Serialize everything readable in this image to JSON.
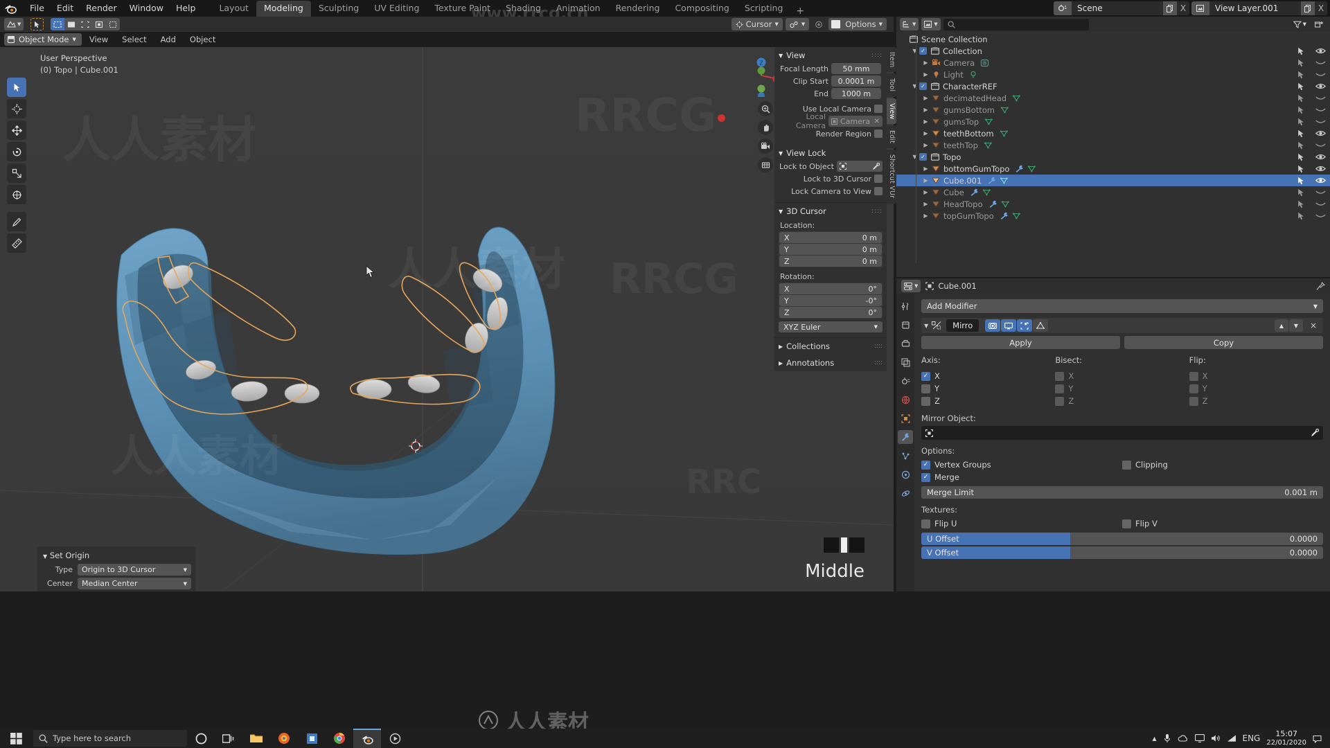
{
  "app": {
    "logo": "blender-logo",
    "menus": [
      "File",
      "Edit",
      "Render",
      "Window",
      "Help"
    ],
    "workspaces": [
      {
        "label": "Layout",
        "active": false
      },
      {
        "label": "Modeling",
        "active": true
      },
      {
        "label": "Sculpting",
        "active": false
      },
      {
        "label": "UV Editing",
        "active": false
      },
      {
        "label": "Texture Paint",
        "active": false
      },
      {
        "label": "Shading",
        "active": false
      },
      {
        "label": "Animation",
        "active": false
      },
      {
        "label": "Rendering",
        "active": false
      },
      {
        "label": "Compositing",
        "active": false
      },
      {
        "label": "Scripting",
        "active": false
      }
    ],
    "add_workspace": "+",
    "scene": {
      "label": "Scene",
      "new_btn": "new-scene",
      "unlink_btn": "X"
    },
    "view_layer": {
      "label": "View Layer.001",
      "new_btn": "new-layer",
      "unlink_btn": "X"
    }
  },
  "viewport_header": {
    "editor_type": "editor-type-3dview",
    "select_modes": [
      "tweak",
      "box",
      "circle",
      "lasso",
      "select-box"
    ],
    "transform_pivot": "Cursor",
    "snap_label": "snap",
    "proportional_label": "proportional-editing",
    "options_label": "Options",
    "shading_modes": [
      "wireframe",
      "solid",
      "material",
      "rendered"
    ],
    "active_shading": "solid"
  },
  "tool_header": {
    "mode": "Object Mode",
    "menus": [
      "View",
      "Select",
      "Add",
      "Object"
    ]
  },
  "viewport": {
    "perspective_label": "User Perspective",
    "scene_stats": "(0) Topo | Cube.001",
    "tools": [
      "tweak-tool",
      "cursor-tool",
      "move-tool",
      "rotate-tool",
      "scale-tool",
      "transform-tool",
      "annotate-tool",
      "measure-tool"
    ],
    "active_tool_index": 0,
    "gizmo_axes": [
      "Z",
      "Y",
      "X"
    ],
    "nav_buttons": [
      "zoom-icon",
      "pan-icon",
      "camera-icon",
      "orthographic-icon"
    ],
    "middle_label": "Middle"
  },
  "operator_panel": {
    "title": "Set Origin",
    "rows": [
      {
        "label": "Type",
        "value": "Origin to 3D Cursor"
      },
      {
        "label": "Center",
        "value": "Median Center"
      }
    ]
  },
  "sidebar": {
    "tabs": [
      {
        "label": "Item",
        "active": false
      },
      {
        "label": "Tool",
        "active": false
      },
      {
        "label": "View",
        "active": true
      },
      {
        "label": "Edit",
        "active": false
      },
      {
        "label": "Shortcut VUr",
        "active": false
      }
    ],
    "view_panel": {
      "title": "View",
      "focal_length_label": "Focal Length",
      "focal_length": "50 mm",
      "clip_start_label": "Clip Start",
      "clip_start": "0.0001 m",
      "end_label": "End",
      "end": "1000 m",
      "use_local_camera_label": "Use Local Camera",
      "use_local_camera": false,
      "local_camera_label": "Local Camera",
      "local_camera_value": "Camera",
      "render_region_label": "Render Region",
      "render_region": false
    },
    "view_lock_panel": {
      "title": "View Lock",
      "lock_to_object_label": "Lock to Object",
      "lock_to_object_value": "",
      "lock_to_3d_cursor_label": "Lock to 3D Cursor",
      "lock_to_3d_cursor": false,
      "lock_camera_to_view_label": "Lock Camera to View",
      "lock_camera_to_view": false
    },
    "cursor_panel": {
      "title": "3D Cursor",
      "location_label": "Location:",
      "location": [
        {
          "axis": "X",
          "value": "0 m"
        },
        {
          "axis": "Y",
          "value": "0 m"
        },
        {
          "axis": "Z",
          "value": "0 m"
        }
      ],
      "rotation_label": "Rotation:",
      "rotation": [
        {
          "axis": "X",
          "value": "0°"
        },
        {
          "axis": "Y",
          "value": "-0°"
        },
        {
          "axis": "Z",
          "value": "0°"
        }
      ],
      "rotation_mode": "XYZ Euler"
    },
    "collapsed_panels": [
      "Collections",
      "Annotations"
    ]
  },
  "outliner": {
    "display_mode": "view-layer",
    "filter_icon": "filter-icon",
    "new_collection_icon": "new-collection-icon",
    "search_placeholder": "",
    "root": "Scene Collection",
    "rows": [
      {
        "name": "Scene Collection",
        "indent": 0,
        "icon": "collection-icon",
        "type": "root",
        "expandable": false,
        "checkbox": false,
        "visible": null,
        "dim": false,
        "selected": false,
        "badges": []
      },
      {
        "name": "Collection",
        "indent": 1,
        "icon": "collection-icon",
        "type": "collection",
        "expandable": true,
        "expanded": true,
        "checkbox": true,
        "visible": true,
        "dim": false,
        "selected": false,
        "badges": []
      },
      {
        "name": "Camera",
        "indent": 2,
        "icon": "camera-obj-icon",
        "type": "object",
        "expandable": true,
        "expanded": false,
        "checkbox": false,
        "visible": false,
        "dim": true,
        "selected": false,
        "badges": [
          "camera-data-icon"
        ]
      },
      {
        "name": "Light",
        "indent": 2,
        "icon": "light-obj-icon",
        "type": "object",
        "expandable": true,
        "expanded": false,
        "checkbox": false,
        "visible": false,
        "dim": true,
        "selected": false,
        "badges": [
          "light-data-icon"
        ]
      },
      {
        "name": "CharacterREF",
        "indent": 1,
        "icon": "collection-icon",
        "type": "collection",
        "expandable": true,
        "expanded": true,
        "checkbox": true,
        "visible": true,
        "dim": false,
        "selected": false,
        "badges": []
      },
      {
        "name": "decimatedHead",
        "indent": 2,
        "icon": "mesh-obj-icon",
        "type": "object",
        "expandable": true,
        "expanded": false,
        "checkbox": false,
        "visible": false,
        "dim": true,
        "selected": false,
        "badges": [
          "mesh-data-icon"
        ]
      },
      {
        "name": "gumsBottom",
        "indent": 2,
        "icon": "mesh-obj-icon",
        "type": "object",
        "expandable": true,
        "expanded": false,
        "checkbox": false,
        "visible": false,
        "dim": true,
        "selected": false,
        "badges": [
          "mesh-data-icon"
        ]
      },
      {
        "name": "gumsTop",
        "indent": 2,
        "icon": "mesh-obj-icon",
        "type": "object",
        "expandable": true,
        "expanded": false,
        "checkbox": false,
        "visible": false,
        "dim": true,
        "selected": false,
        "badges": [
          "mesh-data-icon"
        ]
      },
      {
        "name": "teethBottom",
        "indent": 2,
        "icon": "mesh-obj-icon",
        "type": "object",
        "expandable": true,
        "expanded": false,
        "checkbox": false,
        "visible": true,
        "dim": false,
        "selected": false,
        "badges": [
          "mesh-data-icon"
        ]
      },
      {
        "name": "teethTop",
        "indent": 2,
        "icon": "mesh-obj-icon",
        "type": "object",
        "expandable": true,
        "expanded": false,
        "checkbox": false,
        "visible": false,
        "dim": true,
        "selected": false,
        "badges": [
          "mesh-data-icon"
        ]
      },
      {
        "name": "Topo",
        "indent": 1,
        "icon": "collection-icon",
        "type": "collection",
        "expandable": true,
        "expanded": true,
        "checkbox": true,
        "visible": true,
        "dim": false,
        "selected": false,
        "badges": []
      },
      {
        "name": "bottomGumTopo",
        "indent": 2,
        "icon": "mesh-obj-icon",
        "type": "object",
        "expandable": true,
        "expanded": false,
        "checkbox": false,
        "visible": true,
        "dim": false,
        "selected": false,
        "badges": [
          "modifier-icon",
          "mesh-data-icon"
        ]
      },
      {
        "name": "Cube.001",
        "indent": 2,
        "icon": "mesh-obj-icon",
        "type": "object",
        "expandable": true,
        "expanded": false,
        "checkbox": false,
        "visible": true,
        "dim": false,
        "selected": true,
        "badges": [
          "modifier-icon",
          "mesh-data-icon"
        ]
      },
      {
        "name": "Cube",
        "indent": 2,
        "icon": "mesh-obj-icon",
        "type": "object",
        "expandable": true,
        "expanded": false,
        "checkbox": false,
        "visible": false,
        "dim": true,
        "selected": false,
        "badges": [
          "modifier-icon",
          "mesh-data-icon"
        ]
      },
      {
        "name": "HeadTopo",
        "indent": 2,
        "icon": "mesh-obj-icon",
        "type": "object",
        "expandable": true,
        "expanded": false,
        "checkbox": false,
        "visible": false,
        "dim": true,
        "selected": false,
        "badges": [
          "modifier-icon",
          "mesh-data-icon"
        ]
      },
      {
        "name": "topGumTopo",
        "indent": 2,
        "icon": "mesh-obj-icon",
        "type": "object",
        "expandable": true,
        "expanded": false,
        "checkbox": false,
        "visible": false,
        "dim": true,
        "selected": false,
        "badges": [
          "modifier-icon",
          "mesh-data-icon"
        ]
      }
    ]
  },
  "properties": {
    "breadcrumb_object": "Cube.001",
    "pin_icon": "pin-icon",
    "tabs": [
      "tool-tab",
      "render-tab",
      "output-tab",
      "view-layer-tab",
      "scene-tab",
      "world-tab",
      "object-tab",
      "modifier-tab",
      "particles-tab",
      "physics-tab",
      "constraint-tab"
    ],
    "active_tab": "modifier-tab",
    "add_modifier": "Add Modifier",
    "modifier": {
      "name": "Mirro",
      "icon": "mirror-icon",
      "display_toggles": [
        {
          "name": "render-toggle",
          "on": true
        },
        {
          "name": "realtime-toggle",
          "on": true
        },
        {
          "name": "edit-mode-toggle",
          "on": true
        },
        {
          "name": "on-cage-toggle",
          "on": false
        }
      ],
      "move_up": "▲",
      "move_down": "▼",
      "delete": "×",
      "apply_label": "Apply",
      "copy_label": "Copy",
      "axis_label": "Axis:",
      "bisect_label": "Bisect:",
      "flip_label": "Flip:",
      "axis": [
        {
          "axis": "X",
          "on": true
        },
        {
          "axis": "Y",
          "on": false
        },
        {
          "axis": "Z",
          "on": false
        }
      ],
      "bisect": [
        {
          "axis": "X",
          "on": false
        },
        {
          "axis": "Y",
          "on": false
        },
        {
          "axis": "Z",
          "on": false
        }
      ],
      "flip": [
        {
          "axis": "X",
          "on": false
        },
        {
          "axis": "Y",
          "on": false
        },
        {
          "axis": "Z",
          "on": false
        }
      ],
      "mirror_object_label": "Mirror Object:",
      "mirror_object_value": "",
      "options_label": "Options:",
      "vertex_groups_label": "Vertex Groups",
      "vertex_groups": true,
      "clipping_label": "Clipping",
      "clipping": false,
      "merge_label": "Merge",
      "merge": true,
      "merge_limit_label": "Merge Limit",
      "merge_limit_value": "0.001 m",
      "textures_label": "Textures:",
      "flip_u_label": "Flip U",
      "flip_u": false,
      "flip_v_label": "Flip V",
      "flip_v": false,
      "u_offset_label": "U Offset",
      "u_offset_value": "0.0000",
      "v_offset_label": "V Offset",
      "v_offset_value": "0.0000"
    }
  },
  "taskbar": {
    "search_placeholder": "Type here to search",
    "icons": [
      "cortana-icon",
      "task-view-icon",
      "file-explorer-icon",
      "firefox-icon",
      "store-icon",
      "chrome-icon",
      "blender-icon",
      "media-icon"
    ],
    "tray_icons": [
      "arrow-up-icon",
      "microphone-icon",
      "onedrive-icon",
      "display-icon",
      "volume-icon",
      "network-icon"
    ],
    "language": "ENG",
    "time": "15:07",
    "date": "22/01/2020",
    "notification_icon": "notification-icon"
  },
  "watermarks": {
    "url": "www.rrcg.cn",
    "brand": "人人素材",
    "logo": "rrcg-logo"
  },
  "colors": {
    "accent_blue": "#4772b3",
    "outliner_select": "#4772b3",
    "mesh_orange": "#d48b4a",
    "mesh_data_green": "#3a9e6f",
    "modifier_blue": "#6da5e0",
    "panel_bg": "#303030",
    "header_bg": "#2e2e2e",
    "viewport_bg": "#3b3b3b",
    "model_blue": "#5e93b8",
    "outline_orange": "#e8a65a"
  }
}
